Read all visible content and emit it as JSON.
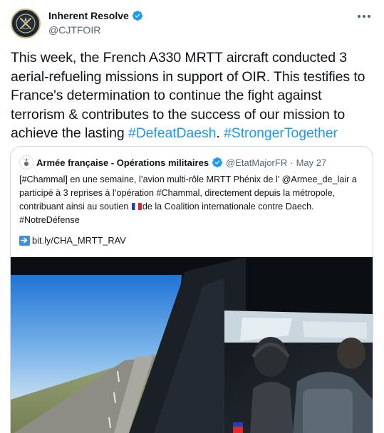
{
  "tweet": {
    "author": {
      "display_name": "Inherent Resolve",
      "handle": "@CJTFOIR",
      "verified": true,
      "avatar_icon": "oir-emblem-icon"
    },
    "text": {
      "plain": "This week, the French A330 MRTT aircraft conducted 3 aerial-refueling missions in support of OIR. This testifies to France's determination to continue the fight against terrorism & contributes to the success of our mission to achieve the lasting ",
      "hashtag_1": "#DefeatDaesh",
      "separator": ". ",
      "hashtag_2": "#StrongerTogether"
    },
    "more_icon": "more-horizontal-icon",
    "colors": {
      "link": "#1d9bf0",
      "verified": "#1d9bf0",
      "text": "#0f1419",
      "secondary": "#536471",
      "border": "#cfd9de"
    }
  },
  "quote": {
    "author": {
      "display_name": "Armée française - Opérations militaires",
      "handle": "@EtatMajorFR",
      "separator": "·",
      "date": "May 27",
      "verified": true,
      "avatar_icon": "grenade-emblem-icon"
    },
    "text": {
      "part_1": "[#Chammal] en une semaine, l’avion multi-rôle MRTT Phénix de l’ @Armee_de_lair a participé à 3 reprises à l’opération #Chammal, directement depuis la métropole, contribuant ainsi au soutien ",
      "flag_icon": "france-flag-icon",
      "part_2": "de la Coalition internationale contre Daech. #NotreDéfense"
    },
    "link": {
      "icon": "right-arrow-icon",
      "label": "bit.ly/CHA_MRTT_RAV"
    },
    "media": {
      "description_icon": "cockpit-video-thumbnail"
    }
  }
}
